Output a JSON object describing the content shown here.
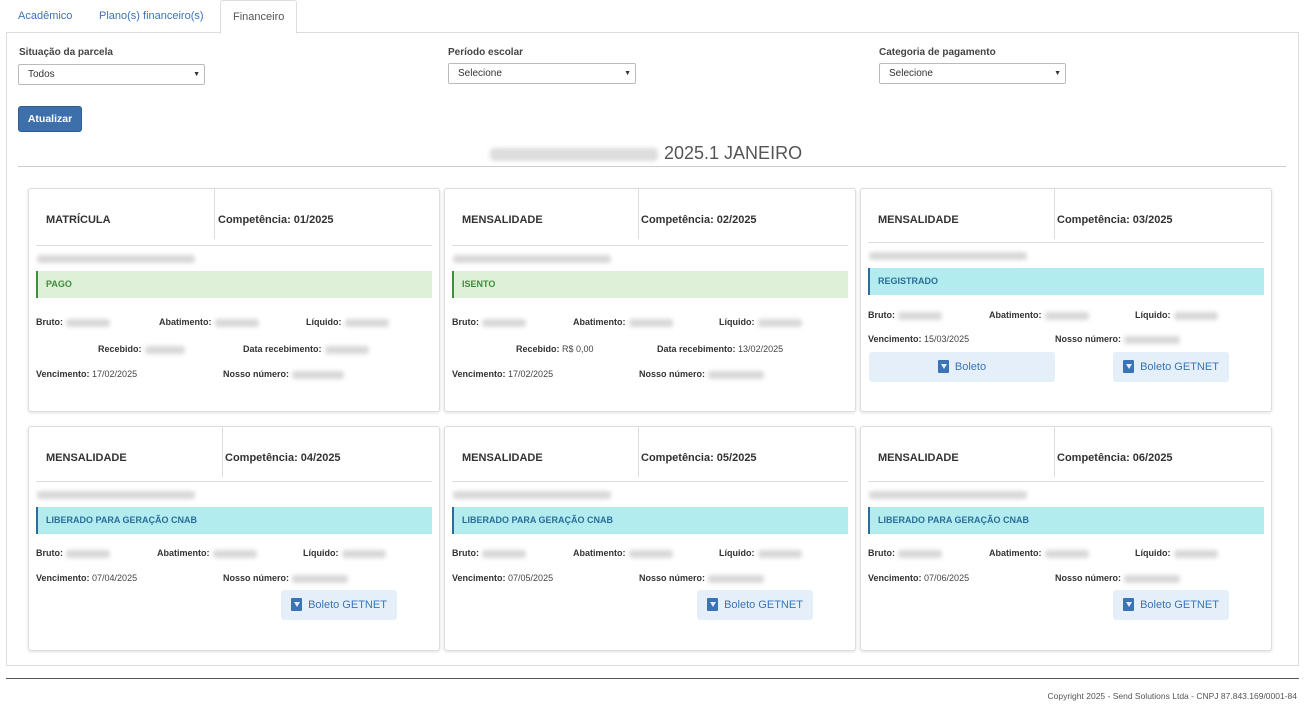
{
  "tabs": [
    "Acadêmico",
    "Plano(s) financeiro(s)",
    "Financeiro"
  ],
  "filters": {
    "situacao_label": "Situação da parcela",
    "situacao_value": "Todos",
    "periodo_label": "Período escolar",
    "periodo_value": "Selecione",
    "categoria_label": "Categoria de pagamento",
    "categoria_value": "Selecione"
  },
  "atualizar_label": "Atualizar",
  "section_title": "2025.1 JANEIRO",
  "labels": {
    "bruto": "Bruto:",
    "abatimento": "Abatimento:",
    "liquido": "Líquido:",
    "recebido": "Recebido:",
    "data_recebimento": "Data recebimento:",
    "vencimento": "Vencimento:",
    "nosso_numero": "Nosso número:"
  },
  "cards": [
    {
      "type": "MATRÍCULA",
      "competencia": "Competência: 01/2025",
      "status": "PAGO",
      "vencimento": "17/02/2025"
    },
    {
      "type": "MENSALIDADE",
      "competencia": "Competência: 02/2025",
      "status": "ISENTO",
      "recebido": "R$ 0,00",
      "data_recebimento": "13/02/2025",
      "vencimento": "17/02/2025"
    },
    {
      "type": "MENSALIDADE",
      "competencia": "Competência: 03/2025",
      "status": "REGISTRADO",
      "vencimento": "15/03/2025"
    },
    {
      "type": "MENSALIDADE",
      "competencia": "Competência: 04/2025",
      "status": "LIBERADO PARA GERAÇÃO CNAB",
      "vencimento": "07/04/2025"
    },
    {
      "type": "MENSALIDADE",
      "competencia": "Competência: 05/2025",
      "status": "LIBERADO PARA GERAÇÃO CNAB",
      "vencimento": "07/05/2025"
    },
    {
      "type": "MENSALIDADE",
      "competencia": "Competência: 06/2025",
      "status": "LIBERADO PARA GERAÇÃO CNAB",
      "vencimento": "07/06/2025"
    }
  ],
  "buttons": {
    "boleto": "Boleto",
    "boleto_getnet": "Boleto GETNET"
  },
  "footer": "Copyright 2025 - Send Solutions Ltda - CNPJ 87.843.169/0001-84",
  "colors": {
    "primary": "#3d6fab",
    "link": "#3b73b9",
    "success_bg": "#dff0d8",
    "info_bg": "#b2ecef"
  }
}
